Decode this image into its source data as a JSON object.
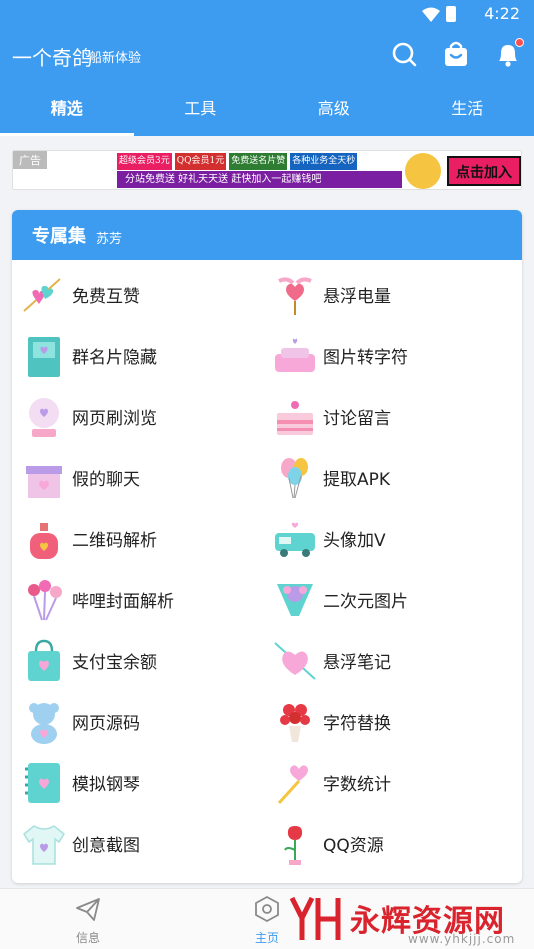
{
  "status": {
    "time": "4:22"
  },
  "app": {
    "title": "一个奇鸽",
    "subtitle": "船新体验"
  },
  "tabs": [
    {
      "label": "精选",
      "active": true
    },
    {
      "label": "工具"
    },
    {
      "label": "高级"
    },
    {
      "label": "生活"
    }
  ],
  "banner": {
    "ad_label": "广告",
    "row1": [
      "超级会员3元",
      "QQ会员1元",
      "免费送名片赞",
      "各种业务全天秒"
    ],
    "row2": "分站免费送 好礼天天送 赶快加入一起赚钱吧",
    "cta": "点击加入"
  },
  "section": {
    "title": "专属集",
    "subtitle": "苏芳",
    "items": [
      {
        "label": "免费互赞",
        "icon": "heart-arrow-icon"
      },
      {
        "label": "悬浮电量",
        "icon": "winged-heart-icon"
      },
      {
        "label": "群名片隐藏",
        "icon": "book-icon"
      },
      {
        "label": "图片转字符",
        "icon": "sofa-icon"
      },
      {
        "label": "网页刷浏览",
        "icon": "crystal-ball-icon"
      },
      {
        "label": "讨论留言",
        "icon": "cake-icon"
      },
      {
        "label": "假的聊天",
        "icon": "gift-box-icon"
      },
      {
        "label": "提取APK",
        "icon": "balloons-icon"
      },
      {
        "label": "二维码解析",
        "icon": "perfume-icon"
      },
      {
        "label": "头像加V",
        "icon": "van-icon"
      },
      {
        "label": "哔哩封面解析",
        "icon": "heart-lollipops-icon"
      },
      {
        "label": "二次元图片",
        "icon": "bouquet-icon"
      },
      {
        "label": "支付宝余额",
        "icon": "shopping-bag-icon"
      },
      {
        "label": "悬浮笔记",
        "icon": "cupid-heart-icon"
      },
      {
        "label": "网页源码",
        "icon": "teddy-bear-icon"
      },
      {
        "label": "字符替换",
        "icon": "rose-bunch-icon"
      },
      {
        "label": "模拟钢琴",
        "icon": "notebook-icon"
      },
      {
        "label": "字数统计",
        "icon": "heart-wand-icon"
      },
      {
        "label": "创意截图",
        "icon": "tshirt-icon"
      },
      {
        "label": "QQ资源",
        "icon": "potted-rose-icon"
      }
    ]
  },
  "bottom_nav": [
    {
      "label": "信息",
      "icon": "paper-plane-icon"
    },
    {
      "label": "主页",
      "icon": "hexagon-icon",
      "active": true
    }
  ],
  "watermark": {
    "text": "永辉资源网",
    "url": "www.yhkjjj.com"
  },
  "colors": {
    "primary": "#3d9cf0",
    "pink": "#f06bb4",
    "teal": "#5fd3d0",
    "lavender": "#b99be8"
  }
}
